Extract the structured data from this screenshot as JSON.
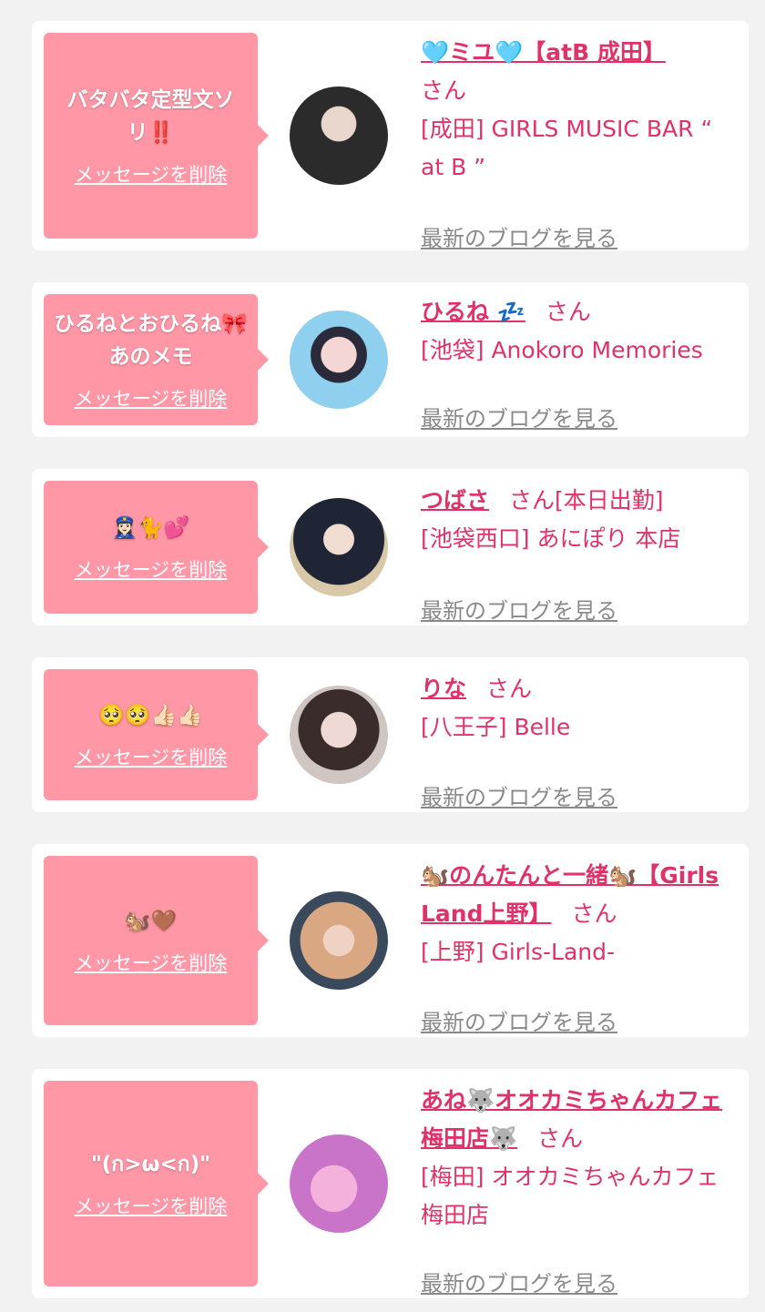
{
  "entries": [
    {
      "message": "バタバタ定型文ソリ‼️",
      "delete_label": "メッセージを削除",
      "name": "🩵ミユ🩵【atB 成田】",
      "san": "さん",
      "tag": "",
      "shop": "[成田] GIRLS MUSIC BAR “ at B ”",
      "blog_label": "最新のブログを見る",
      "avatar_colors": [
        "#2b2b2b",
        "#e9d6cc"
      ]
    },
    {
      "message": "ひるねとおひるね🎀あのメモ",
      "delete_label": "メッセージを削除",
      "name": "ひるね 💤",
      "san": "さん",
      "tag": "",
      "shop": "[池袋] Anokoro Memories",
      "blog_label": "最新のブログを見る",
      "avatar_colors": [
        "#8fd0ee",
        "#f4d7d4"
      ]
    },
    {
      "message": "👮🏻‍♀️🐈💕",
      "delete_label": "メッセージを削除",
      "name": "つばさ",
      "san": "さん",
      "tag": "[本日出勤]",
      "shop": "[池袋西口] あにぽり 本店",
      "blog_label": "最新のブログを見る",
      "avatar_colors": [
        "#d9c9a8",
        "#1f2535"
      ]
    },
    {
      "message": "🥺🥺👍🏻👍🏻",
      "delete_label": "メッセージを削除",
      "name": "りな",
      "san": "さん",
      "tag": "",
      "shop": "[八王子] Belle",
      "blog_label": "最新のブログを見る",
      "avatar_colors": [
        "#cfc6c2",
        "#3a2c2a"
      ]
    },
    {
      "message": "🐿️🤎",
      "delete_label": "メッセージを削除",
      "name": "🐿️のんたんと一緒🐿️【Girls Land上野】",
      "san": "さん",
      "tag": "",
      "shop": "[上野] Girls-Land-",
      "blog_label": "最新のブログを見る",
      "avatar_colors": [
        "#3a4a5c",
        "#d9a882"
      ]
    },
    {
      "message": "\"(ก>ω<ก)\"",
      "delete_label": "メッセージを削除",
      "name": "あね🐺オオカミちゃんカフェ梅田店🐺",
      "san": "さん",
      "tag": "",
      "shop": "[梅田] オオカミちゃんカフェ梅田店",
      "blog_label": "最新のブログを見る",
      "avatar_colors": [
        "#c973c9",
        "#f3b1dc"
      ]
    }
  ]
}
